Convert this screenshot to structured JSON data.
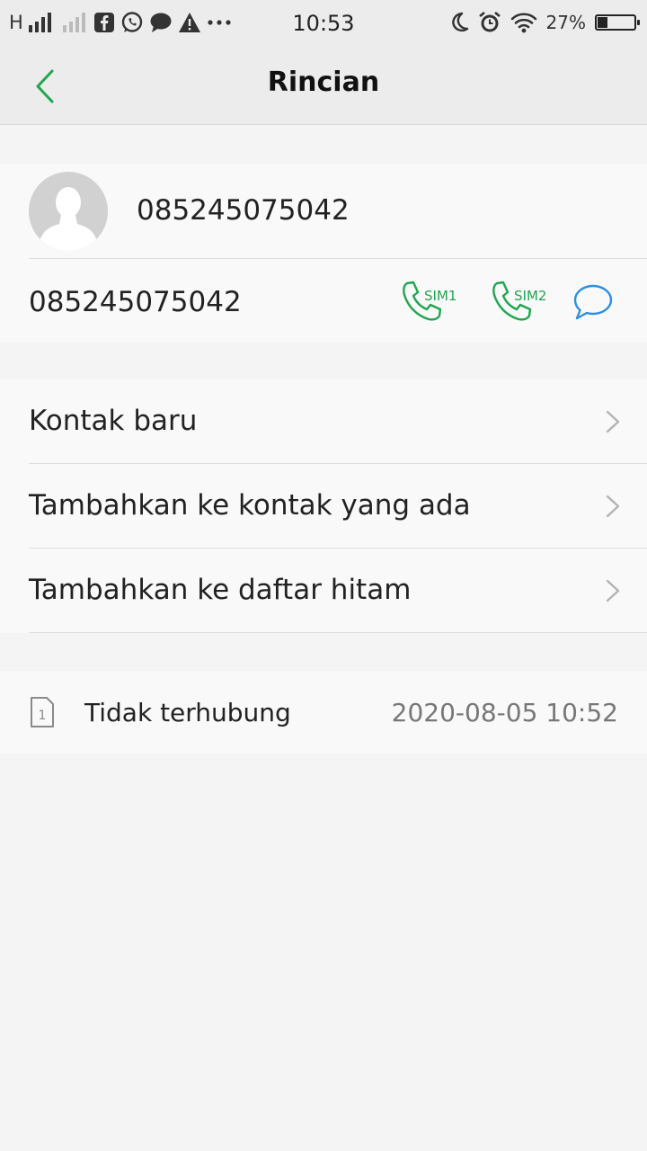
{
  "status_bar": {
    "network_type": "H",
    "time": "10:53",
    "battery_percent": "27%",
    "battery_level": 0.27,
    "left_icons": [
      "signal-bars-icon",
      "signal-bars-weak-icon",
      "facebook-icon",
      "whatsapp-icon",
      "chat-icon",
      "warning-icon",
      "more-dots-icon"
    ],
    "right_icons": [
      "moon-icon",
      "alarm-icon",
      "wifi-icon",
      "battery-icon"
    ]
  },
  "app_bar": {
    "title": "Rincian",
    "back_icon": "chevron-left-icon"
  },
  "contact": {
    "avatar_icon": "avatar-placeholder-icon",
    "header_number": "085245075042",
    "number": "085245075042",
    "actions": [
      {
        "label": "SIM1",
        "icon": "phone-icon"
      },
      {
        "label": "SIM2",
        "icon": "phone-icon"
      },
      {
        "label": "",
        "icon": "message-bubble-icon"
      }
    ]
  },
  "menu": {
    "items": [
      {
        "label": "Kontak baru"
      },
      {
        "label": "Tambahkan ke kontak yang ada"
      },
      {
        "label": "Tambahkan ke daftar hitam"
      }
    ],
    "chevron_icon": "chevron-right-icon"
  },
  "call_log": {
    "sim_icon": "sim-card-icon",
    "sim_number": "1",
    "status": "Tidak terhubung",
    "datetime": "2020-08-05 10:52"
  },
  "colors": {
    "accent_green": "#1fa64e",
    "message_blue": "#2f8fdc",
    "background": "#f4f4f4",
    "card": "#f9f9f9",
    "bar": "#ececec"
  }
}
